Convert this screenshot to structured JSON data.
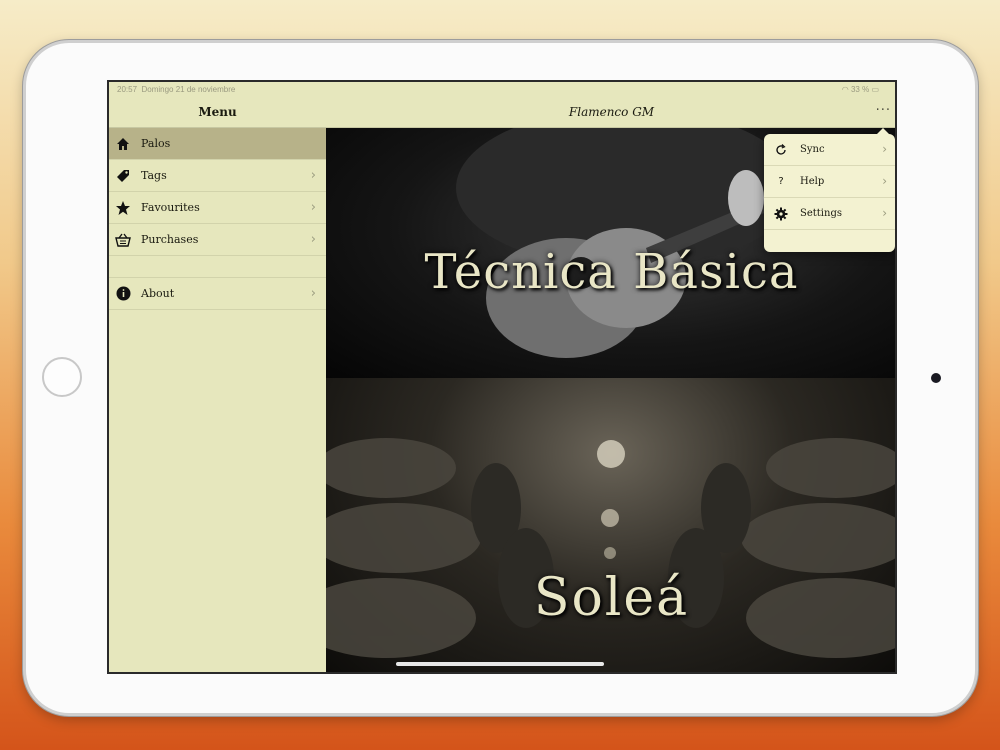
{
  "status_bar": {
    "time": "20:57",
    "date": "Domingo 21 de noviembre",
    "battery": "33 %"
  },
  "sidebar": {
    "title": "Menu",
    "items": [
      {
        "label": "Palos",
        "icon": "home-icon",
        "selected": true
      },
      {
        "label": "Tags",
        "icon": "tag-icon",
        "selected": false
      },
      {
        "label": "Favourites",
        "icon": "star-icon",
        "selected": false
      },
      {
        "label": "Purchases",
        "icon": "basket-icon",
        "selected": false
      }
    ],
    "about": {
      "label": "About",
      "icon": "info-icon"
    }
  },
  "navbar": {
    "title": "Flamenco GM",
    "more_label": "···"
  },
  "banners": [
    {
      "title": "Técnica Básica"
    },
    {
      "title": "Soleá"
    }
  ],
  "popover": {
    "items": [
      {
        "label": "Sync",
        "icon": "refresh-icon"
      },
      {
        "label": "Help",
        "icon": "question-icon",
        "glyph": "?"
      },
      {
        "label": "Settings",
        "icon": "gear-icon"
      }
    ]
  },
  "colors": {
    "sidebar_bg": "#e6e7bd",
    "selected_bg": "#b7b289",
    "title_text": "#e9e6c6"
  }
}
